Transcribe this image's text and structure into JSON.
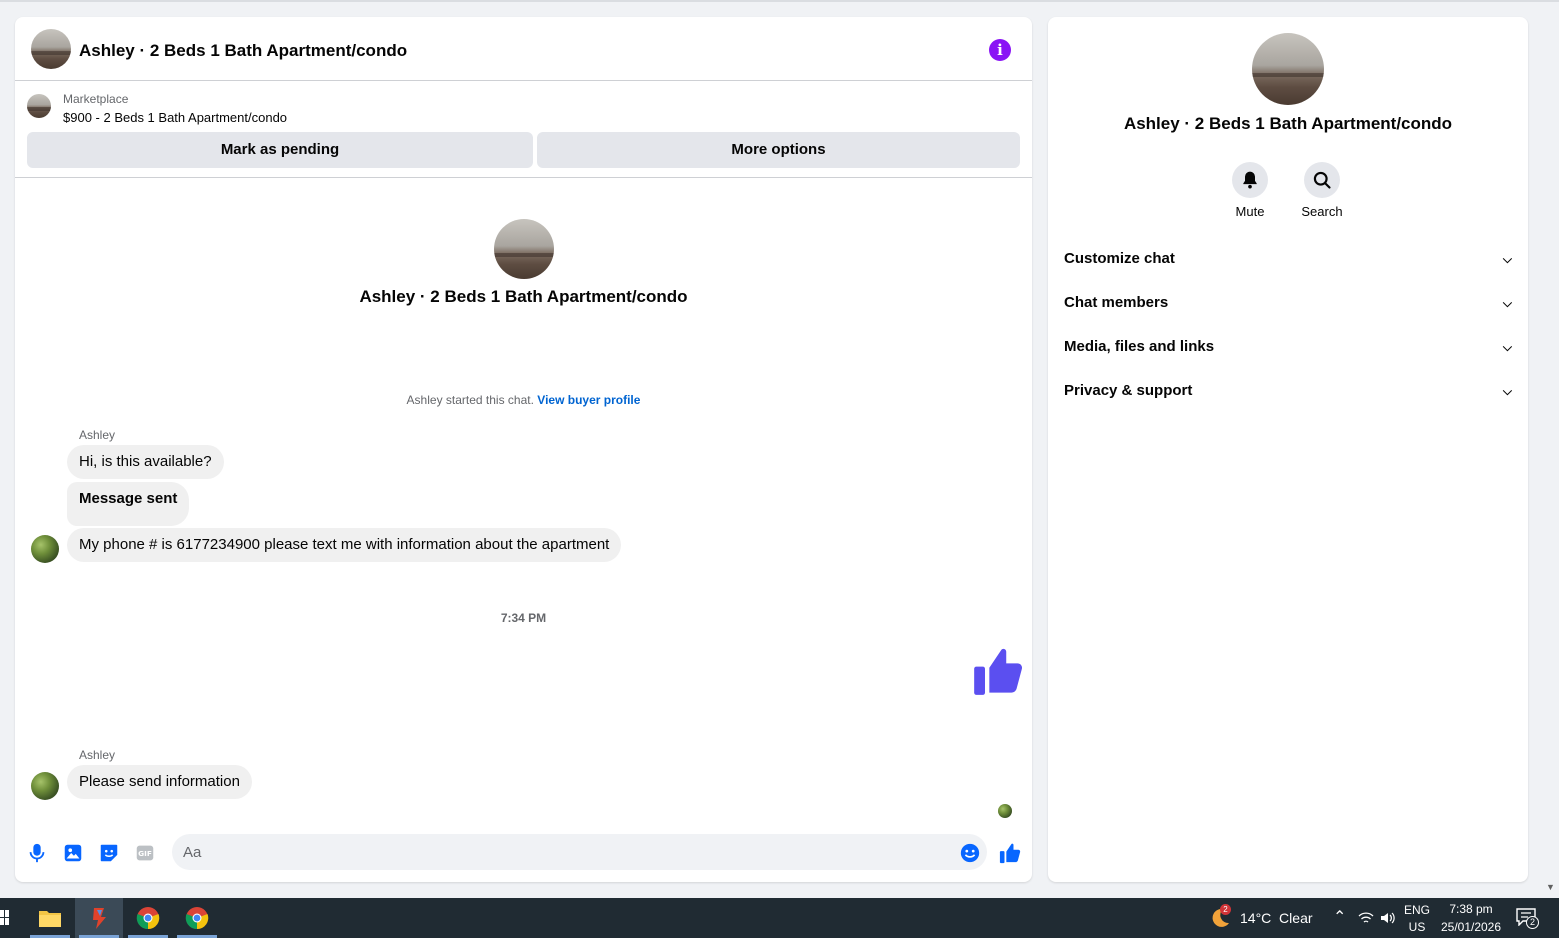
{
  "chat": {
    "title": "Ashley · 2 Beds 1 Bath Apartment/condo",
    "marketplace": {
      "source_label": "Marketplace",
      "listing_label": "$900 - 2 Beds 1 Bath Apartment/condo",
      "mark_pending_label": "Mark as pending",
      "more_options_label": "More options"
    },
    "intro_name": "Ashley · 2 Beds 1 Bath Apartment/condo",
    "started_text": "Ashley started this chat.",
    "view_profile_link": "View buyer profile",
    "messages": [
      {
        "sender": "Ashley",
        "text": "Hi, is this available?"
      },
      {
        "text": "Message sent"
      },
      {
        "text": "My phone # is 6177234900 please text me with information about the apartment"
      }
    ],
    "timestamp": "7:34 PM",
    "messages2": [
      {
        "sender": "Ashley",
        "text": "Please send information"
      }
    ],
    "composer": {
      "placeholder": "Aa"
    }
  },
  "side": {
    "name": "Ashley · 2 Beds 1 Bath Apartment/condo",
    "actions": [
      {
        "label": "Mute",
        "icon": "bell-icon"
      },
      {
        "label": "Search",
        "icon": "search-icon"
      }
    ],
    "sections": [
      {
        "label": "Customize chat"
      },
      {
        "label": "Chat members"
      },
      {
        "label": "Media, files and links"
      },
      {
        "label": "Privacy & support"
      }
    ]
  },
  "taskbar": {
    "weather": "14°C  Clear",
    "weather_badge": "2",
    "lang_top": "ENG",
    "lang_bottom": "US",
    "time": "7:38 pm",
    "date": "25/01/2026",
    "notif_count": "2"
  },
  "colors": {
    "accent_blue": "#0866ff",
    "like_purple": "#5b4ff0",
    "info_purple": "#8a14f5",
    "bubble_gray": "#f0f0f0"
  }
}
